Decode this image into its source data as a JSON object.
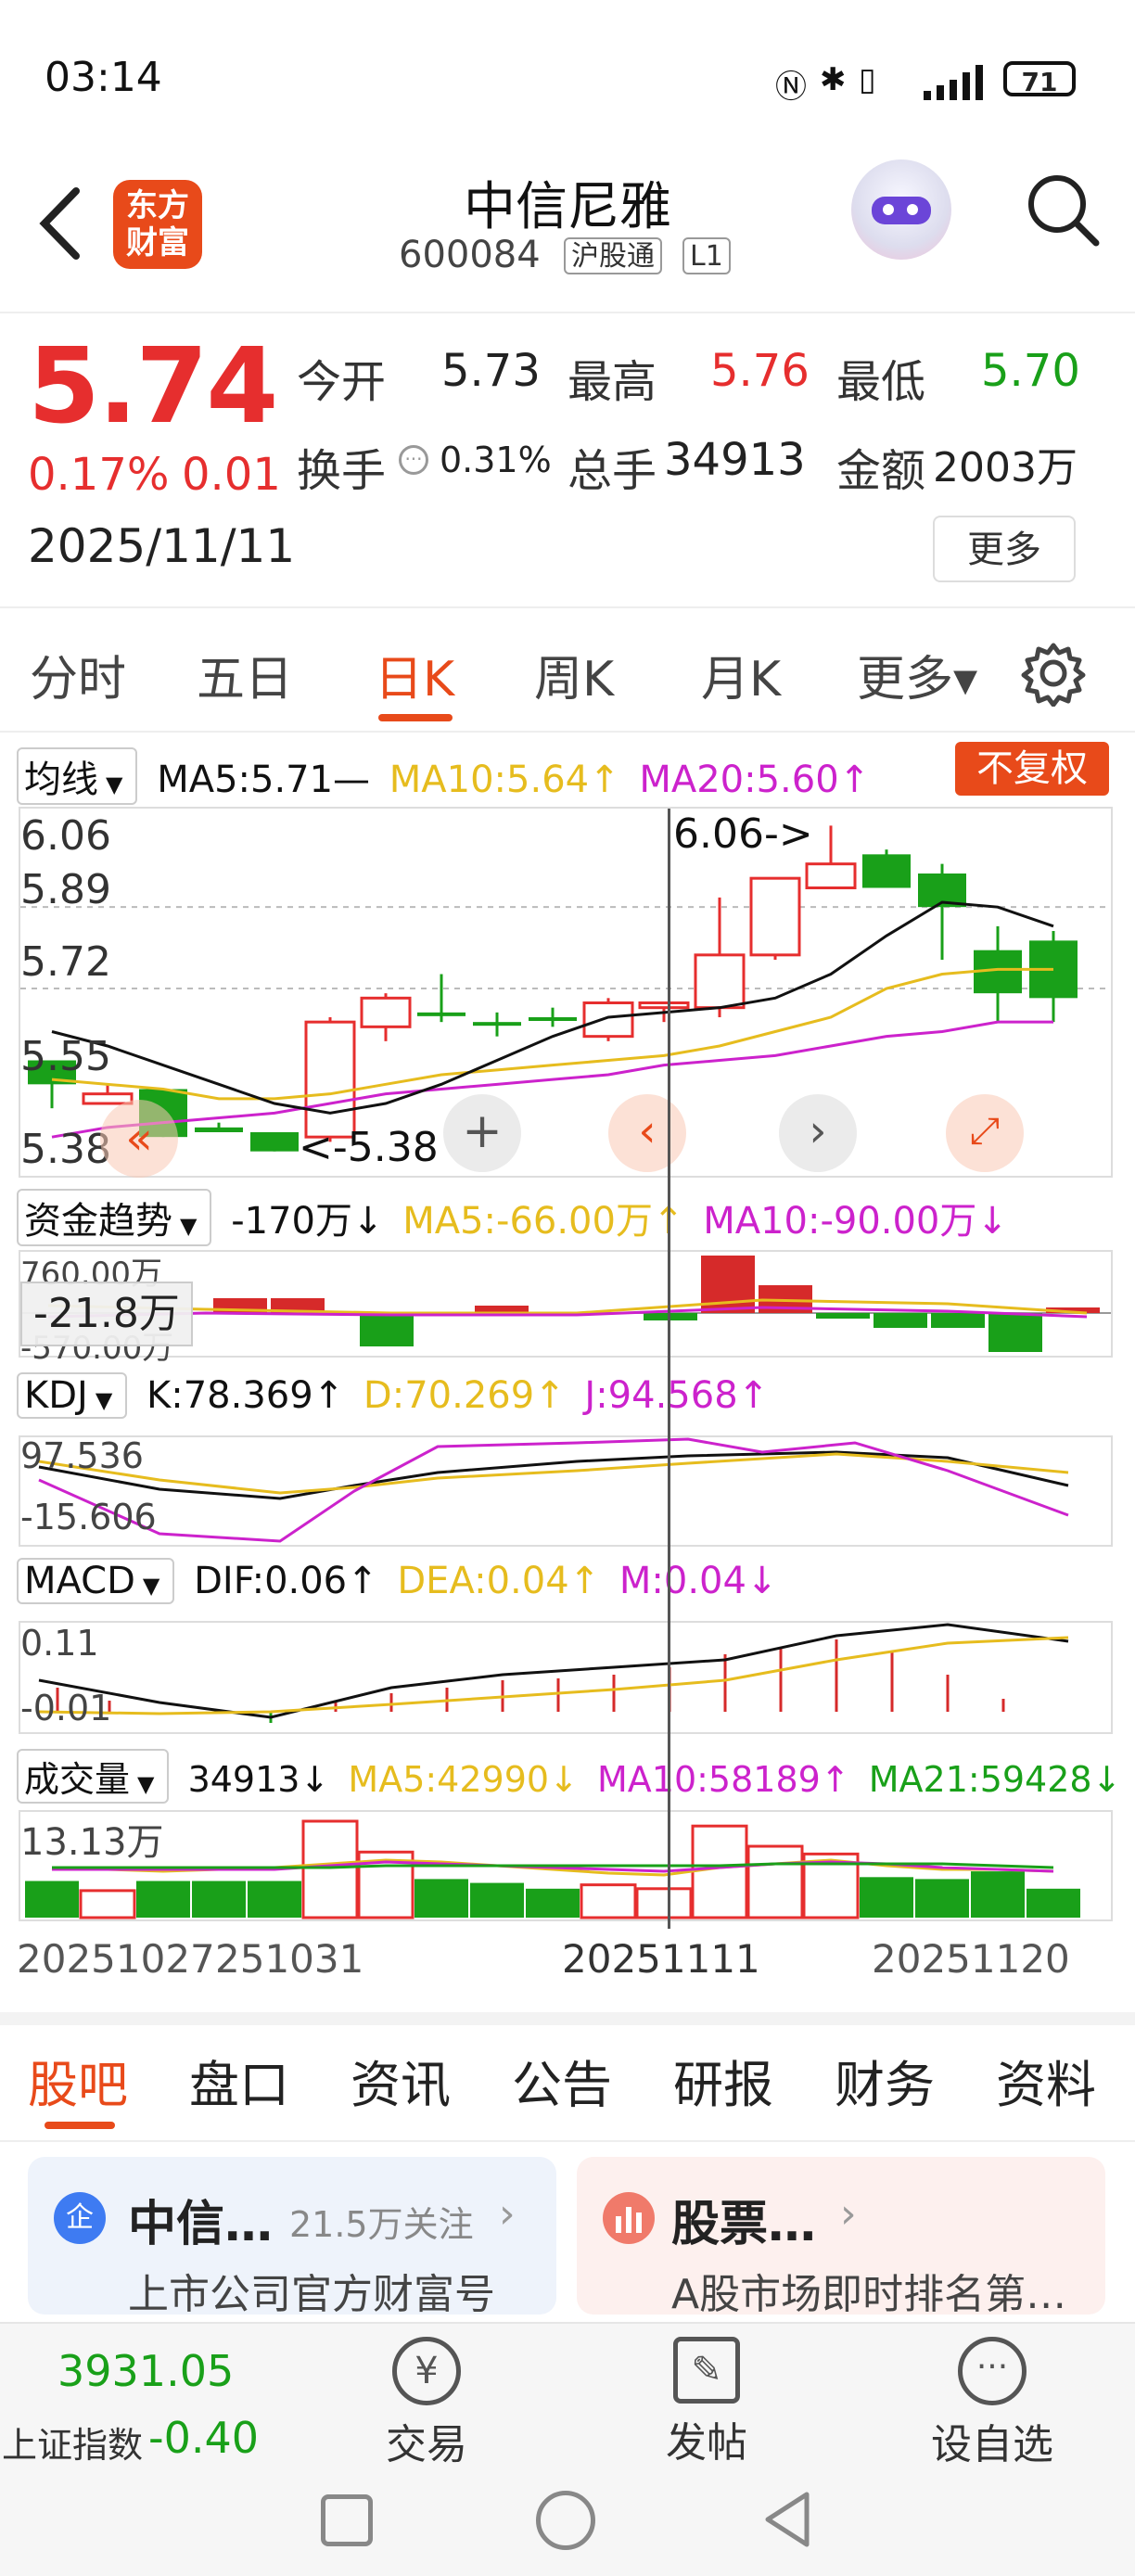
{
  "status_bar": {
    "time": "03:14",
    "battery": "71"
  },
  "header": {
    "stock_name": "中信尼雅",
    "stock_code": "600084",
    "tag_connect": "沪股通",
    "tag_level": "L1",
    "logo_text_line1": "东方",
    "logo_text_line2": "财富"
  },
  "quote": {
    "price": "5.74",
    "change_pct": "0.17%",
    "change": "0.01",
    "date": "2025/11/11",
    "open_label": "今开",
    "open": "5.73",
    "high_label": "最高",
    "high": "5.76",
    "low_label": "最低",
    "low": "5.70",
    "turnover_label": "换手",
    "turnover": "0.31%",
    "volume_label": "总手",
    "volume": "34913",
    "amount_label": "金额",
    "amount": "2003万",
    "more_label": "更多"
  },
  "period_tabs": [
    "分时",
    "五日",
    "日K",
    "周K",
    "月K",
    "更多▾"
  ],
  "active_period": "日K",
  "ma_row": {
    "btn": "均线",
    "ma5": "MA5:5.71—",
    "ma10": "MA10:5.64↑",
    "ma20": "MA20:5.60↑",
    "adjust_btn": "不复权"
  },
  "kline": {
    "y_labels": [
      "6.06",
      "5.89",
      "5.72",
      "5.55",
      "5.38"
    ],
    "max_note": "6.06->",
    "min_note": "<-5.38",
    "colors": {
      "up": "#e62e2e",
      "down": "#19a019",
      "ma5": "#111111",
      "ma10": "#e6bc1e",
      "ma20": "#cc22cc"
    }
  },
  "fund_row": {
    "btn": "资金趋势",
    "value": "-170万↓",
    "ma5": "MA5:-66.00万↑",
    "ma10": "MA10:-90.00万↓",
    "cursor_val": "-21.8万",
    "top_label": "760.00万",
    "bottom_label": "-570.00万"
  },
  "kdj_row": {
    "btn": "KDJ",
    "k": "K:78.369↑",
    "d": "D:70.269↑",
    "j": "J:94.568↑",
    "top_label": "97.536",
    "bottom_label": "-15.606"
  },
  "macd_row": {
    "btn": "MACD",
    "dif": "DIF:0.06↑",
    "dea": "DEA:0.04↑",
    "m": "M:0.04↓",
    "top_label": "0.11",
    "bottom_label": "-0.01"
  },
  "vol_row": {
    "btn": "成交量",
    "value": "34913↓",
    "ma5": "MA5:42990↓",
    "ma10": "MA10:58189↑",
    "ma21": "MA21:59428↓",
    "top_label": "13.13万"
  },
  "x_labels": {
    "left": "20251027",
    "left2": "251031",
    "mid": "20251111",
    "right": "20251120"
  },
  "bottom_tabs": [
    "股吧",
    "盘口",
    "资讯",
    "公告",
    "研报",
    "财务",
    "资料"
  ],
  "cards": [
    {
      "title": "中信…",
      "meta": "21.5万关注",
      "sub": "上市公司官方财富号",
      "badge": "企"
    },
    {
      "title": "股票…",
      "meta": "",
      "sub": "A股市场即时排名第…"
    }
  ],
  "bottom_bar": {
    "index_value": "3931.05",
    "index_name": "上证指数",
    "index_change": "-0.40",
    "trade": "交易",
    "post": "发帖",
    "watch": "设自选"
  },
  "chart_data": {
    "type": "candlestick",
    "candles": [
      {
        "o": 5.52,
        "h": 5.57,
        "l": 5.47,
        "c": 5.57,
        "dir": "down"
      },
      {
        "o": 5.5,
        "h": 5.52,
        "l": 5.48,
        "c": 5.48,
        "dir": "up"
      },
      {
        "o": 5.41,
        "h": 5.51,
        "l": 5.41,
        "c": 5.51,
        "dir": "down"
      },
      {
        "o": 5.42,
        "h": 5.44,
        "l": 5.42,
        "c": 5.43,
        "dir": "down"
      },
      {
        "o": 5.38,
        "h": 5.42,
        "l": 5.38,
        "c": 5.42,
        "dir": "down"
      },
      {
        "o": 5.41,
        "h": 5.66,
        "l": 5.4,
        "c": 5.65,
        "dir": "up"
      },
      {
        "o": 5.64,
        "h": 5.71,
        "l": 5.61,
        "c": 5.7,
        "dir": "up"
      },
      {
        "o": 5.67,
        "h": 5.75,
        "l": 5.65,
        "c": 5.67,
        "dir": "down"
      },
      {
        "o": 5.65,
        "h": 5.67,
        "l": 5.62,
        "c": 5.65,
        "dir": "down"
      },
      {
        "o": 5.66,
        "h": 5.68,
        "l": 5.64,
        "c": 5.66,
        "dir": "down"
      },
      {
        "o": 5.62,
        "h": 5.7,
        "l": 5.61,
        "c": 5.69,
        "dir": "up"
      },
      {
        "o": 5.68,
        "h": 5.69,
        "l": 5.65,
        "c": 5.69,
        "dir": "up"
      },
      {
        "o": 5.68,
        "h": 5.91,
        "l": 5.66,
        "c": 5.79,
        "dir": "up"
      },
      {
        "o": 5.79,
        "h": 5.95,
        "l": 5.78,
        "c": 5.95,
        "dir": "up"
      },
      {
        "o": 5.93,
        "h": 6.06,
        "l": 5.93,
        "c": 5.98,
        "dir": "up"
      },
      {
        "o": 6.0,
        "h": 6.01,
        "l": 5.93,
        "c": 5.93,
        "dir": "down"
      },
      {
        "o": 5.96,
        "h": 5.98,
        "l": 5.78,
        "c": 5.89,
        "dir": "down"
      },
      {
        "o": 5.8,
        "h": 5.85,
        "l": 5.65,
        "c": 5.71,
        "dir": "down"
      },
      {
        "o": 5.82,
        "h": 5.84,
        "l": 5.65,
        "c": 5.7,
        "dir": "down"
      }
    ],
    "ma5": [
      5.63,
      5.6,
      5.56,
      5.52,
      5.48,
      5.46,
      5.48,
      5.52,
      5.57,
      5.62,
      5.66,
      5.67,
      5.68,
      5.7,
      5.75,
      5.83,
      5.9,
      5.89,
      5.85
    ],
    "ma10": [
      5.53,
      5.52,
      5.51,
      5.49,
      5.49,
      5.5,
      5.52,
      5.54,
      5.55,
      5.56,
      5.57,
      5.58,
      5.6,
      5.63,
      5.66,
      5.72,
      5.75,
      5.76,
      5.76
    ],
    "ma20": [
      5.41,
      5.43,
      5.44,
      5.45,
      5.46,
      5.48,
      5.5,
      5.51,
      5.52,
      5.53,
      5.54,
      5.56,
      5.57,
      5.58,
      5.6,
      5.62,
      5.63,
      5.65,
      5.65
    ],
    "ylim": [
      5.36,
      6.08
    ]
  }
}
